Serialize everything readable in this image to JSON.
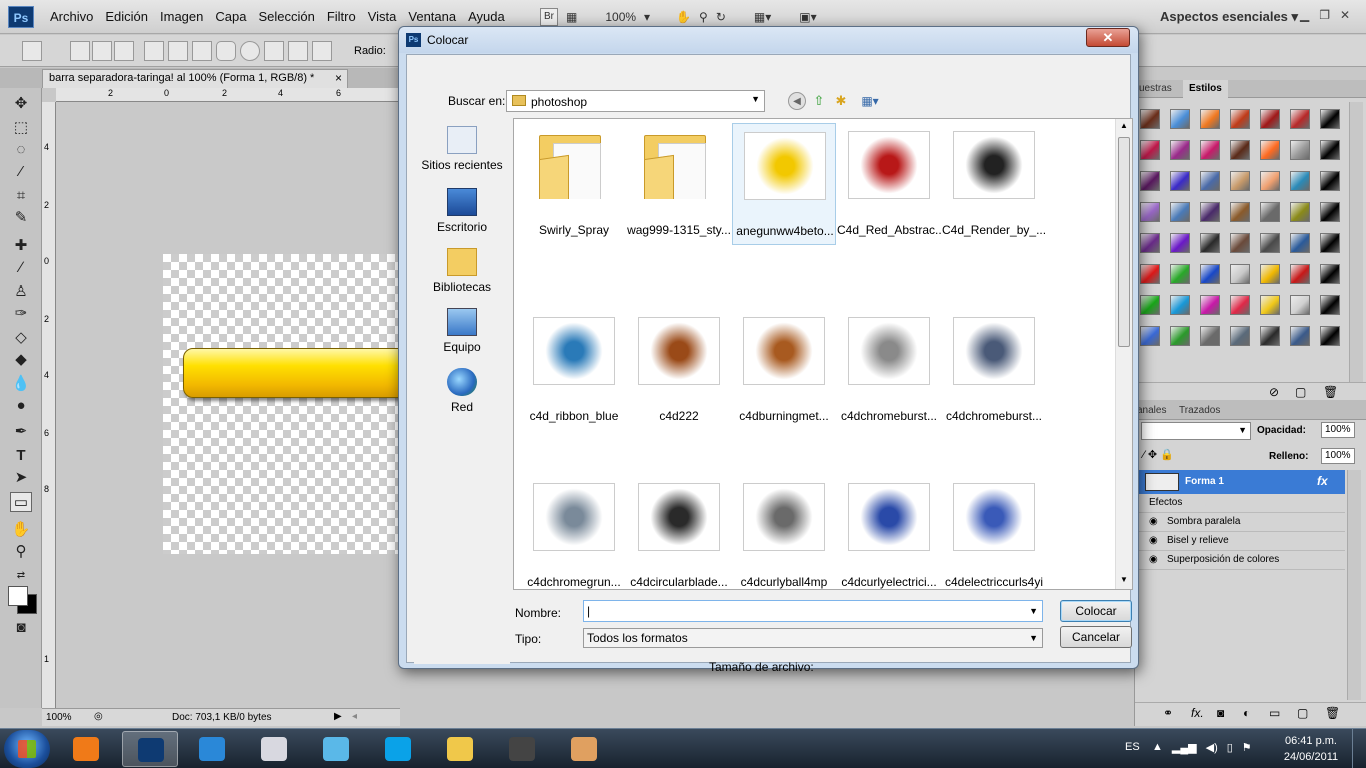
{
  "app": {
    "logo": "Ps",
    "menus": [
      "Archivo",
      "Edición",
      "Imagen",
      "Capa",
      "Selección",
      "Filtro",
      "Vista",
      "Ventana",
      "Ayuda"
    ],
    "bridge_label": "Br",
    "zoom_menu": "100%",
    "workspace": "Aspectos esenciales"
  },
  "options": {
    "radio_label": "Radio:"
  },
  "document": {
    "tab_title": "barra separadora-taringa! al 100% (Forma 1, RGB/8) *",
    "tab_close": "×",
    "zoom": "100%",
    "doc_size": "Doc: 703,1 KB/0 bytes"
  },
  "ruler": {
    "top_ticks": [
      "2",
      "0",
      "2",
      "4",
      "6"
    ],
    "left_ticks": [
      "4",
      "2",
      "0",
      "2",
      "4",
      "6",
      "8",
      "1"
    ]
  },
  "styles_panel": {
    "tabs": [
      "uestras",
      "Estilos"
    ],
    "swatches": [
      "#6b2e1a",
      "#4a8ed8",
      "#f07820",
      "#c03a18",
      "#a01818",
      "#b82828",
      "#000",
      "#c0184a",
      "#9a2a8a",
      "#c81a6a",
      "#5a2a18",
      "#ff6a20",
      "#9a9a9a",
      "#000",
      "#5a1860",
      "#3a2ac8",
      "#4a6aa8",
      "#c89a6a",
      "#f0a070",
      "#2a8ab8",
      "#000",
      "#9a68c8",
      "#4a7ab8",
      "#4a2a6a",
      "#8a5a2a",
      "#6a6a6a",
      "#8a8a18",
      "#000",
      "#6a2a8a",
      "#6a18c8",
      "#2a2a2a",
      "#6a4a3a",
      "#4a4a4a",
      "#2a5a9a",
      "#000",
      "#e01818",
      "#28a828",
      "#1848c8",
      "#c8c8c8",
      "#f0b800",
      "#c81818",
      "#000",
      "#18a818",
      "#1898d8",
      "#c818a8",
      "#e02848",
      "#f0c818",
      "#d0d0d0",
      "#000",
      "#3a6ad8",
      "#2a9a2a",
      "#6a6a6a",
      "#5a6a7a",
      "#2a2a2a",
      "#3a5a8a",
      "#000"
    ]
  },
  "layers_panel": {
    "tabs": [
      "anales",
      "Trazados"
    ],
    "opacity_label": "Opacidad:",
    "opacity_value": "100%",
    "fill_label": "Relleno:",
    "fill_value": "100%",
    "layer_name": "Forma 1",
    "fx": "fx",
    "effects_label": "Efectos",
    "effects": [
      "Sombra paralela",
      "Bisel y relieve",
      "Superposición de colores"
    ]
  },
  "dialog": {
    "title": "Colocar",
    "close": "✕",
    "look_in_label": "Buscar en:",
    "look_in_value": "photoshop",
    "places": [
      "Sitios recientes",
      "Escritorio",
      "Bibliotecas",
      "Equipo",
      "Red"
    ],
    "files": [
      {
        "name": "Swirly_Spray",
        "kind": "folder"
      },
      {
        "name": "wag999-1315_sty...",
        "kind": "folder"
      },
      {
        "name": "anegunww4beto...",
        "kind": "image",
        "color": "#f2c800"
      },
      {
        "name": "C4d_Red_Abstrac...",
        "kind": "image",
        "color": "#b81818"
      },
      {
        "name": "C4d_Render_by_...",
        "kind": "image",
        "color": "#222222"
      },
      {
        "name": "c4d_ribbon_blue",
        "kind": "image",
        "color": "#2a7ab8"
      },
      {
        "name": "c4d222",
        "kind": "image",
        "color": "#9a4a18"
      },
      {
        "name": "c4dburningmet...",
        "kind": "image",
        "color": "#a85a20"
      },
      {
        "name": "c4dchromeburst...",
        "kind": "image",
        "color": "#8a8a8a"
      },
      {
        "name": "c4dchromeburst...",
        "kind": "image",
        "color": "#4a5a78"
      },
      {
        "name": "c4dchromegrun...",
        "kind": "image",
        "color": "#7a8a9a"
      },
      {
        "name": "c4dcircularblade...",
        "kind": "image",
        "color": "#2a2a2a"
      },
      {
        "name": "c4dcurlyball4mp",
        "kind": "image",
        "color": "#6a6a6a"
      },
      {
        "name": "c4dcurlyelectrici...",
        "kind": "image",
        "color": "#2a4aa8"
      },
      {
        "name": "c4delectriccurls4yi",
        "kind": "image",
        "color": "#3a5ab8"
      }
    ],
    "selected_index": 2,
    "name_label": "Nombre:",
    "name_value": "",
    "type_label": "Tipo:",
    "type_value": "Todos los formatos",
    "place_button": "Colocar",
    "cancel_button": "Cancelar",
    "filesize_label": "Tamaño de archivo:"
  },
  "taskbar": {
    "lang": "ES",
    "time": "06:41 p.m.",
    "date": "24/06/2011",
    "tasks": [
      {
        "name": "media",
        "color": "#f07a18"
      },
      {
        "name": "photoshop",
        "color": "#0e3a72",
        "active": true
      },
      {
        "name": "ie",
        "color": "#2a88d8"
      },
      {
        "name": "calculator",
        "color": "#d8d8e0"
      },
      {
        "name": "notes",
        "color": "#5ab8e8"
      },
      {
        "name": "skype",
        "color": "#0aa2e8"
      },
      {
        "name": "explorer",
        "color": "#f0c84a"
      },
      {
        "name": "chrome",
        "color": "#444"
      },
      {
        "name": "paint",
        "color": "#e0a060"
      }
    ]
  }
}
